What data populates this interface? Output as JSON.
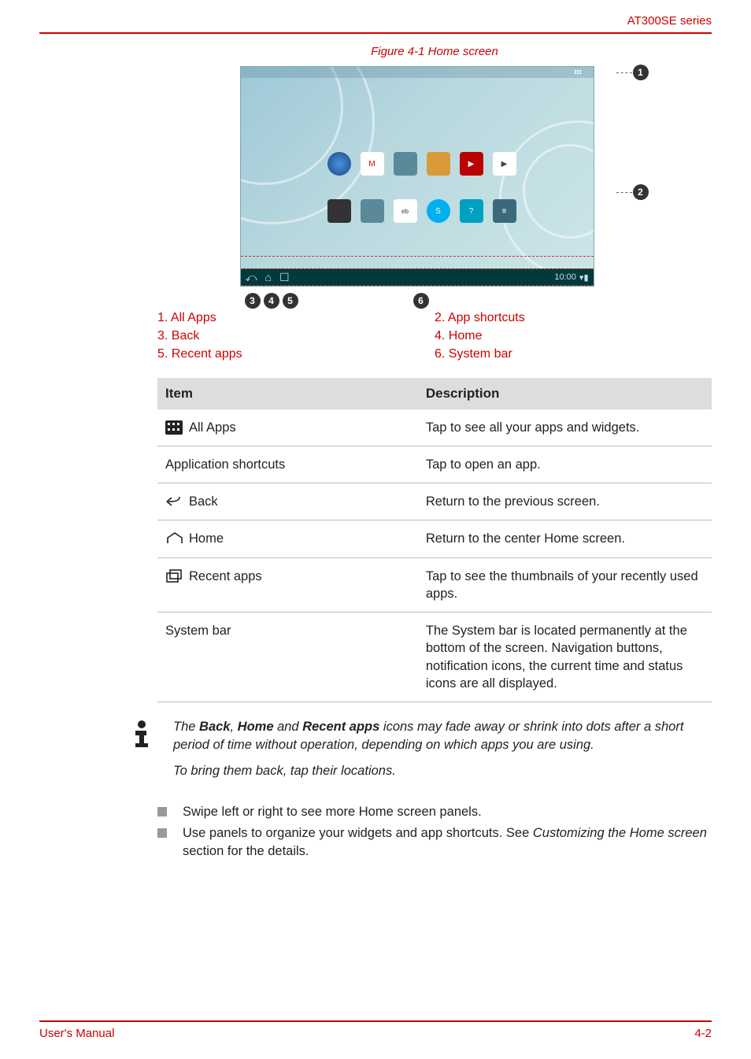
{
  "header": {
    "series": "AT300SE series"
  },
  "figure": {
    "caption": "Figure 4-1 Home screen"
  },
  "homescreen": {
    "time": "10:00",
    "row1_icons": [
      "globe",
      "gmail",
      "misc",
      "maps",
      "yt",
      "play"
    ],
    "row2_icons": [
      "camera",
      "misc",
      "ebay",
      "skype",
      "help",
      "settings"
    ]
  },
  "callouts": {
    "c1": "1",
    "c2": "2",
    "c3": "3",
    "c4": "4",
    "c5": "5",
    "c6": "6"
  },
  "legend": {
    "l1": "1. All Apps",
    "l2": "2. App shortcuts",
    "l3": "3. Back",
    "l4": "4. Home",
    "l5": "5. Recent apps",
    "l6": "6. System bar"
  },
  "table": {
    "h1": "Item",
    "h2": "Description",
    "rows": [
      {
        "item": "All Apps",
        "icon": "allapps",
        "desc": "Tap to see all your apps and widgets."
      },
      {
        "item": "Application shortcuts",
        "icon": "",
        "desc": "Tap to open an app."
      },
      {
        "item": "Back",
        "icon": "back",
        "desc": "Return to the previous screen."
      },
      {
        "item": "Home",
        "icon": "home",
        "desc": "Return to the center Home screen."
      },
      {
        "item": "Recent apps",
        "icon": "recent",
        "desc": "Tap to see the thumbnails of your recently used apps."
      },
      {
        "item": "System bar",
        "icon": "",
        "desc": "The System bar is located permanently at the bottom of the screen. Navigation buttons, notification icons, the current time and status icons are all displayed."
      }
    ]
  },
  "note": {
    "p1_a": "The ",
    "p1_b": "Back",
    "p1_c": ", ",
    "p1_d": "Home",
    "p1_e": " and ",
    "p1_f": "Recent apps",
    "p1_g": " icons may fade away or shrink into dots after a short period of time without operation, depending on which apps you are using.",
    "p2": "To bring them back, tap their locations."
  },
  "bullets": {
    "b1": "Swipe left or right to see more Home screen panels.",
    "b2_a": "Use panels to organize your widgets and app shortcuts. See ",
    "b2_link": "Customizing the Home screen",
    "b2_b": " section for the details."
  },
  "footer": {
    "left": "User's Manual",
    "right": "4-2"
  }
}
